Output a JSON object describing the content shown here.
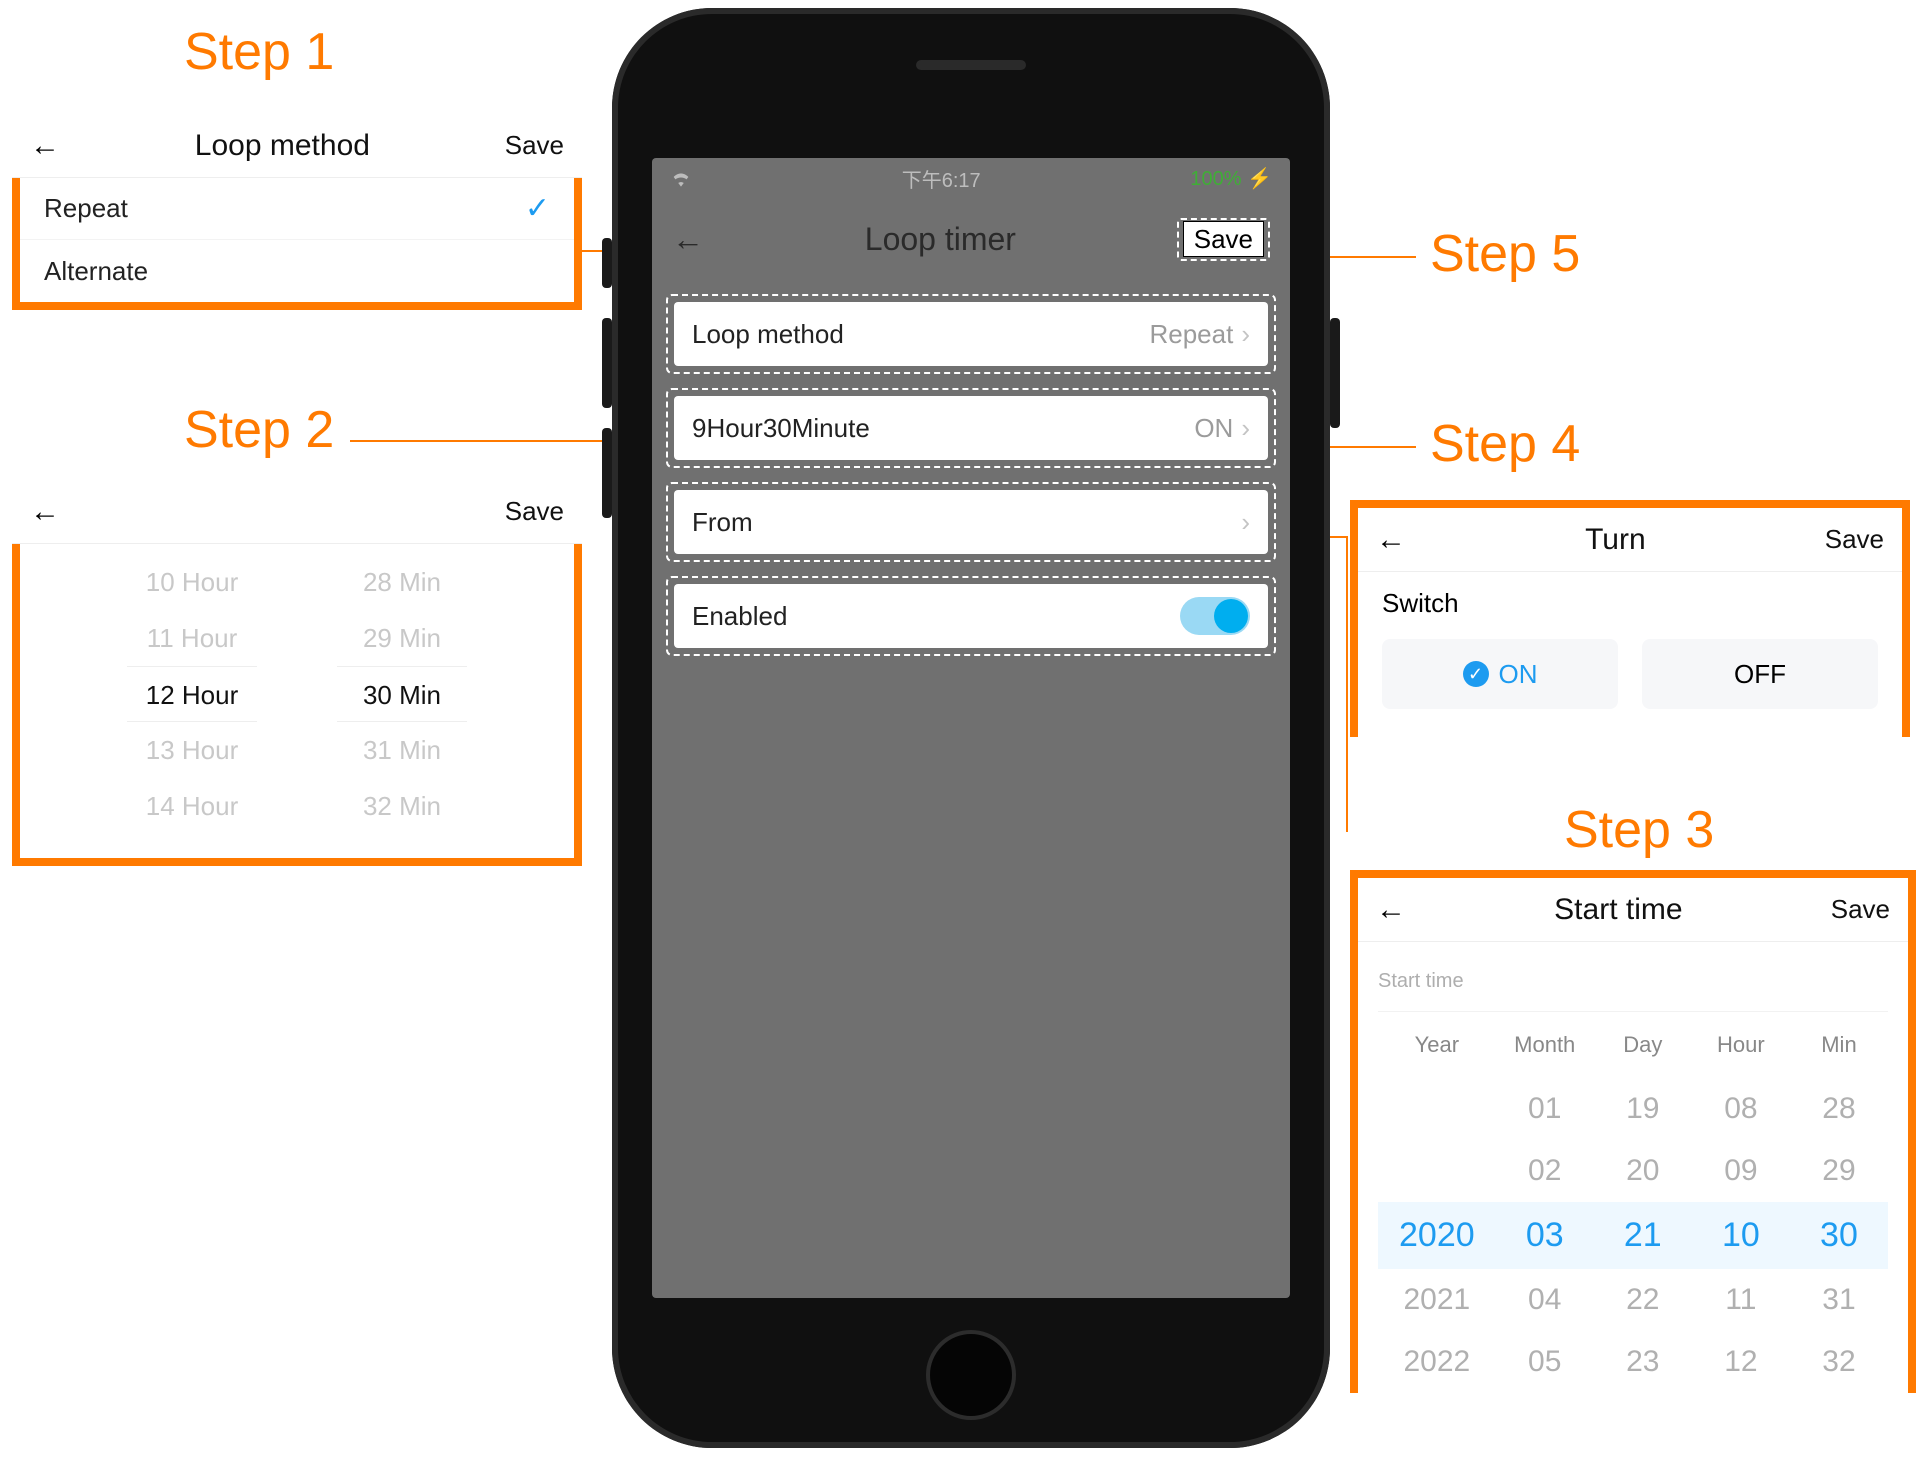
{
  "steps": {
    "s1": "Step 1",
    "s2": "Step 2",
    "s3": "Step 3",
    "s4": "Step 4",
    "s5": "Step 5"
  },
  "phone": {
    "status": {
      "time": "下午6:17",
      "battery": "100%"
    },
    "header": {
      "title": "Loop timer",
      "save": "Save"
    },
    "rows": {
      "loop_method": {
        "label": "Loop method",
        "value": "Repeat"
      },
      "duration": {
        "label": "9Hour30Minute",
        "value": "ON"
      },
      "from": {
        "label": "From"
      },
      "enabled": {
        "label": "Enabled"
      }
    }
  },
  "loop_method_panel": {
    "title": "Loop method",
    "save": "Save",
    "options": [
      "Repeat",
      "Alternate"
    ],
    "selected": "Repeat"
  },
  "duration_panel": {
    "save": "Save",
    "hours": [
      "10 Hour",
      "11 Hour",
      "12 Hour",
      "13 Hour",
      "14 Hour"
    ],
    "minutes": [
      "28 Min",
      "29 Min",
      "30 Min",
      "31 Min",
      "32 Min"
    ],
    "selected_hour": "12 Hour",
    "selected_min": "30 Min"
  },
  "turn_panel": {
    "title": "Turn",
    "save": "Save",
    "switch_label": "Switch",
    "on": "ON",
    "off": "OFF"
  },
  "start_time_panel": {
    "title": "Start time",
    "save": "Save",
    "sub": "Start time",
    "headers": [
      "Year",
      "Month",
      "Day",
      "Hour",
      "Min"
    ],
    "cols": {
      "year": [
        "",
        "",
        "2020",
        "2021",
        "2022"
      ],
      "month": [
        "01",
        "02",
        "03",
        "04",
        "05"
      ],
      "day": [
        "19",
        "20",
        "21",
        "22",
        "23"
      ],
      "hour": [
        "08",
        "09",
        "10",
        "11",
        "12"
      ],
      "min": [
        "28",
        "29",
        "30",
        "31",
        "32"
      ]
    },
    "selected_row_index": 2
  }
}
